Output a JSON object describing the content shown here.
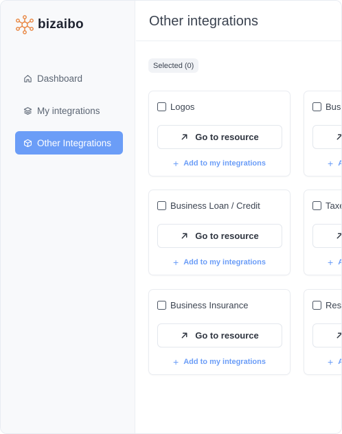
{
  "brand": {
    "name": "bizaibo",
    "accent": "#e8823b"
  },
  "sidebar": {
    "items": [
      {
        "label": "Dashboard",
        "icon": "home-icon",
        "active": false
      },
      {
        "label": "My integrations",
        "icon": "layers-icon",
        "active": false
      },
      {
        "label": "Other Integrations",
        "icon": "box-icon",
        "active": true
      }
    ]
  },
  "header": {
    "title": "Other integrations"
  },
  "filter": {
    "selected_label": "Selected (0)"
  },
  "cards": [
    {
      "title": "Logos",
      "button": "Go to resource",
      "add": "Add to my integrations"
    },
    {
      "title": "Busi",
      "button": "",
      "add": "A"
    },
    {
      "title": "Business Loan / Credit",
      "button": "Go to resource",
      "add": "Add to my integrations"
    },
    {
      "title": "Taxe",
      "button": "",
      "add": "A"
    },
    {
      "title": "Business Insurance",
      "button": "Go to resource",
      "add": "Add to my integrations"
    },
    {
      "title": "Rest",
      "button": "",
      "add": "A"
    }
  ],
  "colors": {
    "primary": "#6b9df7",
    "sidebar_bg": "#f8f9fb"
  }
}
